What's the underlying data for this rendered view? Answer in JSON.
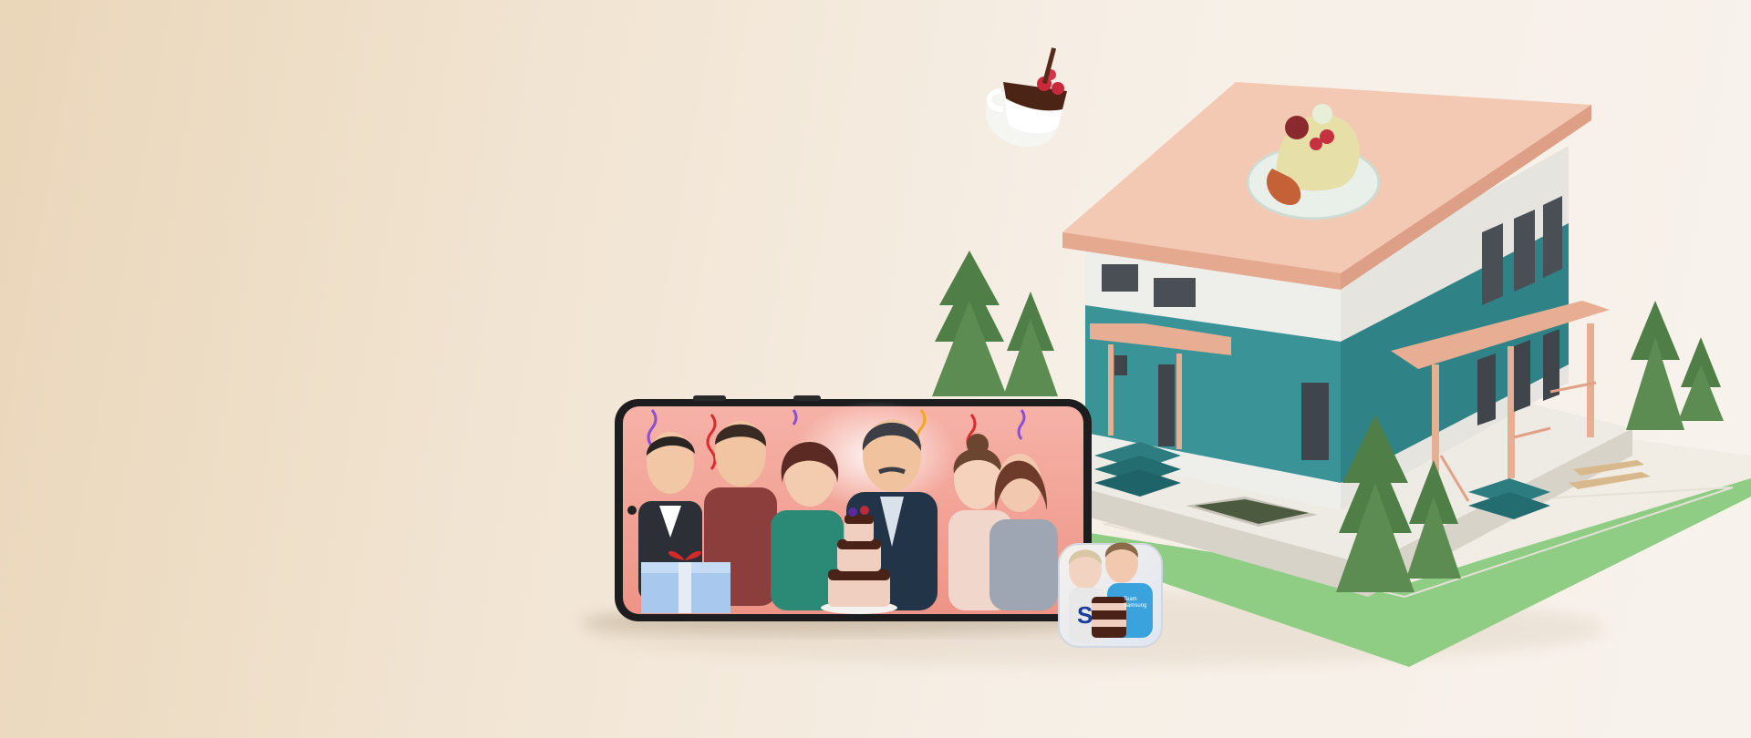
{
  "scene": {
    "background_colors": [
      "#ead6b9",
      "#f6efe6"
    ],
    "phone": {
      "frame_color": "#1d1d1f",
      "screen_background": "#f2a89f",
      "characters": [
        "man-suit",
        "man-red-shirt",
        "woman-green-top",
        "man-mustache",
        "woman-bun",
        "woman-long-hair"
      ],
      "props": [
        "gift-box",
        "chocolate-cake",
        "streamers"
      ]
    },
    "app_icon": {
      "label": "S",
      "badge_text": "Team Samsung",
      "accent": "#1b3d9c"
    },
    "house": {
      "roof_color": "#f4c9b4",
      "wall_teal": "#3a9396",
      "wall_white": "#eeeeea",
      "trim_color": "#e5a98f"
    },
    "lawn_color": "#8fcc84",
    "tree_color": "#4f7f46",
    "desserts": [
      "teacup-with-raspberries",
      "plate-with-dessert"
    ]
  }
}
